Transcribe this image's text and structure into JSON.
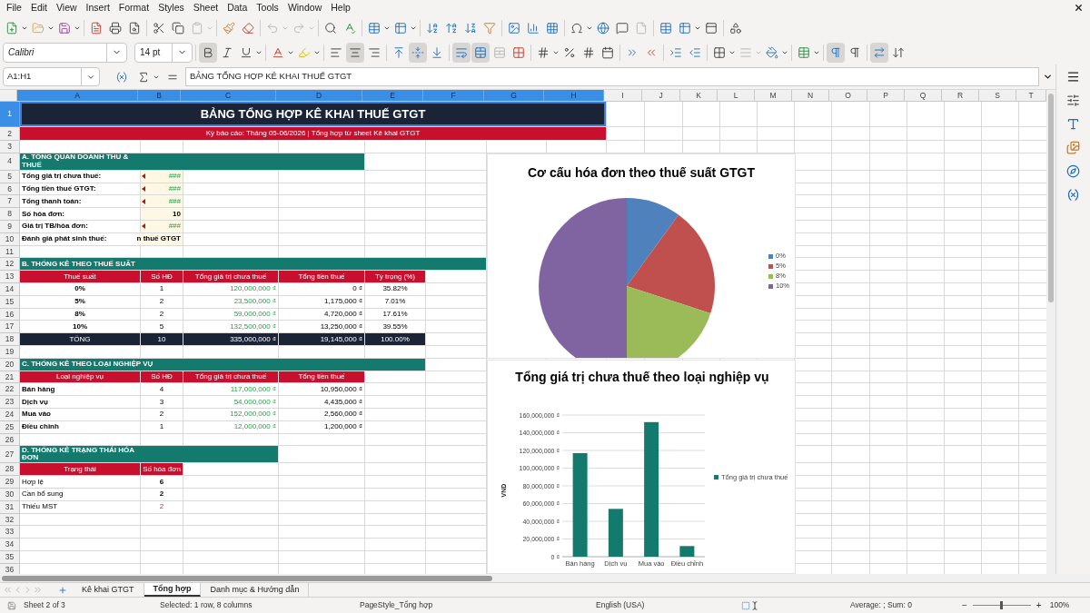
{
  "menu": [
    "File",
    "Edit",
    "View",
    "Insert",
    "Format",
    "Styles",
    "Sheet",
    "Data",
    "Tools",
    "Window",
    "Help"
  ],
  "font_name": "Calibri",
  "font_size": "14 pt",
  "format_toolbar": {
    "bold": {
      "pressed": true
    },
    "italic": {
      "pressed": false
    },
    "underline": {
      "pressed": false
    },
    "align_left": {
      "pressed": false
    },
    "align_center": {
      "pressed": true
    },
    "align_right": {
      "pressed": false
    },
    "align_top": {
      "pressed": false
    },
    "align_middle": {
      "pressed": true
    },
    "align_bottom": {
      "pressed": false
    },
    "wrap_text": {
      "pressed": true
    },
    "merge_center": {
      "pressed": true
    },
    "left_to_right": {
      "pressed": true
    },
    "right_to_left": {
      "pressed": false
    },
    "text_direction": {
      "pressed": true
    }
  },
  "formula_bar": {
    "name_box": "A1:H1",
    "content": "BẢNG TỔNG HỢP KÊ KHAI THUẾ GTGT"
  },
  "sheet": {
    "columns": [
      {
        "label": "A",
        "selected": true
      },
      {
        "label": "B",
        "selected": true
      },
      {
        "label": "C",
        "selected": true
      },
      {
        "label": "D",
        "selected": true
      },
      {
        "label": "E",
        "selected": true
      },
      {
        "label": "F",
        "selected": true
      },
      {
        "label": "G",
        "selected": true
      },
      {
        "label": "H",
        "selected": true
      },
      {
        "label": "I",
        "selected": false
      },
      {
        "label": "J",
        "selected": false
      },
      {
        "label": "K",
        "selected": false
      },
      {
        "label": "L",
        "selected": false
      },
      {
        "label": "M",
        "selected": false
      },
      {
        "label": "N",
        "selected": false
      },
      {
        "label": "O",
        "selected": false
      },
      {
        "label": "P",
        "selected": false
      },
      {
        "label": "Q",
        "selected": false
      },
      {
        "label": "R",
        "selected": false
      },
      {
        "label": "S",
        "selected": false
      },
      {
        "label": "T",
        "selected": false
      }
    ],
    "rows": [
      {
        "number": "1",
        "selected": true,
        "kind": "title",
        "cells": [
          {
            "kind": "title",
            "text": "BẢNG TỔNG HỢP KÊ KHAI THUẾ GTGT"
          }
        ]
      },
      {
        "number": "2",
        "selected": false,
        "kind": "subtitle",
        "cells": [
          {
            "kind": "subtitle",
            "text": "Kỳ báo cáo: Tháng 05-06/2026 | Tổng hợp từ sheet Kê khai GTGT"
          }
        ]
      },
      {
        "number": "3",
        "selected": false,
        "kind": "blank"
      },
      {
        "number": "4",
        "selected": false,
        "kind": "section",
        "cells": [
          {
            "kind": "section",
            "text": "A. TỔNG QUAN DOANH THU & THUẾ"
          }
        ]
      },
      {
        "number": "5",
        "selected": false,
        "kind": "data",
        "cells": [
          {
            "kind": "label",
            "text": "Tổng giá trị chưa thuế:"
          },
          {
            "kind": "inputamount",
            "text": "###",
            "clipped": true
          }
        ]
      },
      {
        "number": "6",
        "selected": false,
        "kind": "data",
        "cells": [
          {
            "kind": "label",
            "text": "Tổng tiền thuế GTGT:"
          },
          {
            "kind": "inputamount",
            "text": "###",
            "clipped": true
          }
        ]
      },
      {
        "number": "7",
        "selected": false,
        "kind": "data",
        "cells": [
          {
            "kind": "label",
            "text": "Tổng thanh toán:"
          },
          {
            "kind": "inputamount",
            "text": "###",
            "clipped": true
          }
        ]
      },
      {
        "number": "8",
        "selected": false,
        "kind": "data",
        "cells": [
          {
            "kind": "label",
            "text": "Số hóa đơn:"
          },
          {
            "kind": "inputtext",
            "text": "10",
            "clipped": false
          }
        ]
      },
      {
        "number": "9",
        "selected": false,
        "kind": "data",
        "cells": [
          {
            "kind": "label",
            "text": "Giá trị TB/hóa đơn:"
          },
          {
            "kind": "inputamount",
            "text": "###",
            "clipped": true
          }
        ]
      },
      {
        "number": "10",
        "selected": false,
        "kind": "data",
        "cells": [
          {
            "kind": "label",
            "text": "Đánh giá phát sinh thuế:"
          },
          {
            "kind": "inputtext",
            "text": "n thuế GTGT",
            "clipped": true
          }
        ]
      },
      {
        "number": "11",
        "selected": false,
        "kind": "blank"
      },
      {
        "number": "12",
        "selected": false,
        "kind": "section",
        "cells": [
          {
            "kind": "section",
            "text": "B. THỐNG KÊ THEO THUẾ SUẤT"
          }
        ]
      },
      {
        "number": "13",
        "selected": false,
        "kind": "data",
        "cells": [
          {
            "kind": "header",
            "text": "Thuế suất"
          },
          {
            "kind": "header",
            "text": "Số HĐ"
          },
          {
            "kind": "header",
            "text": "Tổng giá trị chưa thuế"
          },
          {
            "kind": "header",
            "text": "Tổng tiền thuế"
          },
          {
            "kind": "header",
            "text": "Tỷ trọng (%)"
          }
        ]
      },
      {
        "number": "14",
        "selected": false,
        "kind": "data",
        "cells": [
          {
            "kind": "rate",
            "text": "0%"
          },
          {
            "kind": "number",
            "text": "1"
          },
          {
            "kind": "amount",
            "text": "120,000,000 ₫"
          },
          {
            "kind": "money",
            "text": "0 ₫"
          },
          {
            "kind": "percent",
            "text": "35.82%"
          }
        ]
      },
      {
        "number": "15",
        "selected": false,
        "kind": "data",
        "cells": [
          {
            "kind": "rate",
            "text": "5%"
          },
          {
            "kind": "number",
            "text": "2"
          },
          {
            "kind": "amount",
            "text": "23,500,000 ₫"
          },
          {
            "kind": "money",
            "text": "1,175,000 ₫"
          },
          {
            "kind": "percent",
            "text": "7.01%"
          }
        ]
      },
      {
        "number": "16",
        "selected": false,
        "kind": "data",
        "cells": [
          {
            "kind": "rate",
            "text": "8%"
          },
          {
            "kind": "number",
            "text": "2"
          },
          {
            "kind": "amount",
            "text": "59,000,000 ₫"
          },
          {
            "kind": "money",
            "text": "4,720,000 ₫"
          },
          {
            "kind": "percent",
            "text": "17.61%"
          }
        ]
      },
      {
        "number": "17",
        "selected": false,
        "kind": "data",
        "cells": [
          {
            "kind": "rate",
            "text": "10%"
          },
          {
            "kind": "number",
            "text": "5"
          },
          {
            "kind": "amount",
            "text": "132,500,000 ₫"
          },
          {
            "kind": "money",
            "text": "13,250,000 ₫"
          },
          {
            "kind": "percent",
            "text": "39.55%"
          }
        ]
      },
      {
        "number": "18",
        "selected": false,
        "kind": "data",
        "cells": [
          {
            "kind": "total",
            "text": "TỔNG"
          },
          {
            "kind": "total",
            "text": "10"
          },
          {
            "kind": "totalmoney",
            "text": "335,000,000 ₫"
          },
          {
            "kind": "totalmoney",
            "text": "19,145,000 ₫"
          },
          {
            "kind": "total",
            "text": "100.00%"
          }
        ]
      },
      {
        "number": "19",
        "selected": false,
        "kind": "blank"
      },
      {
        "number": "20",
        "selected": false,
        "kind": "section",
        "cells": [
          {
            "kind": "section",
            "text": "C. THỐNG KÊ THEO LOẠI NGHIỆP VỤ"
          }
        ]
      },
      {
        "number": "21",
        "selected": false,
        "kind": "data",
        "cells": [
          {
            "kind": "header",
            "text": "Loại nghiệp vụ"
          },
          {
            "kind": "header",
            "text": "Số HĐ"
          },
          {
            "kind": "header",
            "text": "Tổng giá trị chưa thuế"
          },
          {
            "kind": "header",
            "text": "Tổng tiền thuế"
          }
        ]
      },
      {
        "number": "22",
        "selected": false,
        "kind": "data",
        "cells": [
          {
            "kind": "label",
            "text": "Bán hàng"
          },
          {
            "kind": "number",
            "text": "4"
          },
          {
            "kind": "amount",
            "text": "117,000,000 ₫"
          },
          {
            "kind": "money",
            "text": "10,950,000 ₫"
          }
        ]
      },
      {
        "number": "23",
        "selected": false,
        "kind": "data",
        "cells": [
          {
            "kind": "label",
            "text": "Dịch vụ"
          },
          {
            "kind": "number",
            "text": "3"
          },
          {
            "kind": "amount",
            "text": "54,000,000 ₫"
          },
          {
            "kind": "money",
            "text": "4,435,000 ₫"
          }
        ]
      },
      {
        "number": "24",
        "selected": false,
        "kind": "data",
        "cells": [
          {
            "kind": "label",
            "text": "Mua vào"
          },
          {
            "kind": "number",
            "text": "2"
          },
          {
            "kind": "amount",
            "text": "152,000,000 ₫"
          },
          {
            "kind": "money",
            "text": "2,560,000 ₫"
          }
        ]
      },
      {
        "number": "25",
        "selected": false,
        "kind": "data",
        "cells": [
          {
            "kind": "label",
            "text": "Điều chỉnh"
          },
          {
            "kind": "number",
            "text": "1"
          },
          {
            "kind": "amount",
            "text": "12,000,000 ₫"
          },
          {
            "kind": "money",
            "text": "1,200,000 ₫"
          }
        ]
      },
      {
        "number": "26",
        "selected": false,
        "kind": "blank"
      },
      {
        "number": "27",
        "selected": false,
        "kind": "section",
        "cells": [
          {
            "kind": "section",
            "text": "D. THỐNG KÊ TRẠNG THÁI HÓA ĐƠN"
          }
        ]
      },
      {
        "number": "28",
        "selected": false,
        "kind": "data",
        "cells": [
          {
            "kind": "header",
            "text": "Trạng thái"
          },
          {
            "kind": "header",
            "text": "Số hóa đơn"
          }
        ]
      },
      {
        "number": "29",
        "selected": false,
        "kind": "data",
        "cells": [
          {
            "kind": "name",
            "text": "Hợp lệ"
          },
          {
            "kind": "tally",
            "text": "6"
          }
        ]
      },
      {
        "number": "30",
        "selected": false,
        "kind": "data",
        "cells": [
          {
            "kind": "name",
            "text": "Cần bổ sung"
          },
          {
            "kind": "tally",
            "text": "2"
          }
        ]
      },
      {
        "number": "31",
        "selected": false,
        "kind": "data",
        "cells": [
          {
            "kind": "name",
            "text": "Thiếu MST"
          },
          {
            "kind": "alert",
            "text": "2"
          }
        ]
      },
      {
        "number": "32",
        "selected": false,
        "kind": "blank"
      },
      {
        "number": "33",
        "selected": false,
        "kind": "blank"
      },
      {
        "number": "34",
        "selected": false,
        "kind": "blank"
      },
      {
        "number": "35",
        "selected": false,
        "kind": "blank"
      },
      {
        "number": "36",
        "selected": false,
        "kind": "blank"
      }
    ]
  },
  "pie_chart": {
    "chart_data": {
      "type": "pie",
      "title": "Cơ cấu hóa đơn theo thuế suất GTGT",
      "categories": [
        "0%",
        "5%",
        "8%",
        "10%"
      ],
      "values": [
        10,
        20,
        20,
        50
      ],
      "legend": "right",
      "colors": [
        "#4f81bd",
        "#c0504d",
        "#9bbb59",
        "#8064a2"
      ]
    }
  },
  "bar_chart": {
    "chart_data": {
      "type": "bar",
      "title": "Tổng giá trị chưa thuế theo loại nghiệp vụ",
      "ylabel": "VND",
      "categories": [
        "Bán hàng",
        "Dịch vụ",
        "Mua vào",
        "Điều chỉnh"
      ],
      "series": [
        {
          "name": "Tổng giá trị chưa thuế",
          "color": "#157a6e",
          "values": [
            117000000,
            54000000,
            152000000,
            12000000
          ]
        }
      ],
      "ylim": [
        0,
        160000000
      ],
      "legend": "right",
      "grid": true,
      "yticks": [
        {
          "value": 0,
          "label": "0 ₫"
        },
        {
          "value": 20000000,
          "label": "20,000,000 ₫"
        },
        {
          "value": 40000000,
          "label": "40,000,000 ₫"
        },
        {
          "value": 60000000,
          "label": "60,000,000 ₫"
        },
        {
          "value": 80000000,
          "label": "80,000,000 ₫"
        },
        {
          "value": 100000000,
          "label": "100,000,000 ₫"
        },
        {
          "value": 120000000,
          "label": "120,000,000 ₫"
        },
        {
          "value": 140000000,
          "label": "140,000,000 ₫"
        },
        {
          "value": 160000000,
          "label": "160,000,000 ₫"
        }
      ]
    }
  },
  "sheet_tabs": [
    {
      "label": "Kê khai GTGT",
      "selected": false
    },
    {
      "label": "Tổng hợp",
      "selected": true
    },
    {
      "label": "Danh mục & Hướng dẫn",
      "selected": false
    }
  ],
  "status_bar": {
    "sheet": "Sheet 2 of 3",
    "selection": "Selected: 1 row, 8 columns",
    "page_style": "PageStyle_Tổng hợp",
    "language": "English (USA)",
    "sum": "Average: ; Sum: 0",
    "zoom_out": "−",
    "zoom_in": "+",
    "zoom": {
      "level": 0.5
    },
    "zoom_value": "100%"
  }
}
